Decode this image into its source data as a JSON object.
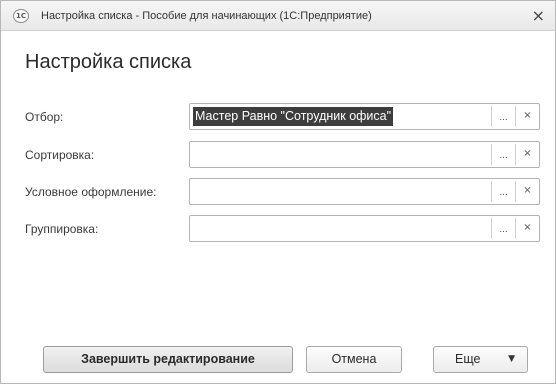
{
  "window": {
    "icon_text": "1С",
    "title": "Настройка списка - Пособие для начинающих  (1С:Предприятие)",
    "close_glyph": "×"
  },
  "heading": "Настройка списка",
  "fields": {
    "filter": {
      "label": "Отбор:",
      "value": "Мастер Равно \"Сотрудник офиса\""
    },
    "sort": {
      "label": "Сортировка:",
      "value": ""
    },
    "conditional": {
      "label": "Условное оформление:",
      "value": ""
    },
    "grouping": {
      "label": "Группировка:",
      "value": ""
    }
  },
  "field_buttons": {
    "select": "...",
    "clear": "×"
  },
  "buttons": {
    "finish": "Завершить редактирование",
    "cancel": "Отмена",
    "more": "Еще",
    "more_arrow": "▼"
  },
  "colors": {
    "selection_bg": "#3d3d3d",
    "border": "#b5b5b5"
  }
}
